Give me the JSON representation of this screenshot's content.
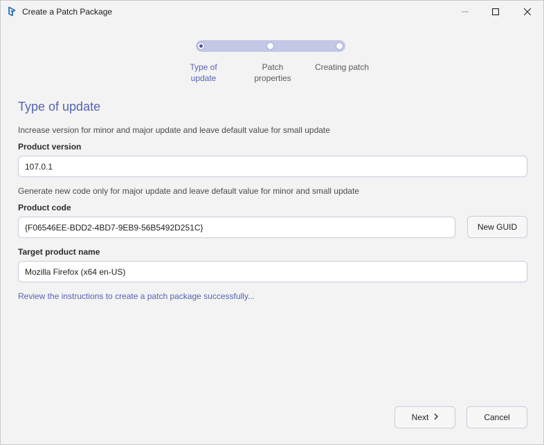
{
  "window": {
    "title": "Create a Patch Package"
  },
  "stepper": {
    "steps": [
      {
        "label_line1": "Type of",
        "label_line2": "update"
      },
      {
        "label_line1": "Patch",
        "label_line2": "properties"
      },
      {
        "label_line1": "Creating patch",
        "label_line2": ""
      }
    ],
    "active_step": 1
  },
  "form": {
    "title": "Type of update",
    "version_hint": "Increase version for minor and major update and leave default value for small update",
    "version_label": "Product version",
    "version_value": "107.0.1",
    "code_hint": "Generate new code only for major update and leave default value for minor and small update",
    "code_label": "Product code",
    "code_value": "{F06546EE-BDD2-4BD7-9EB9-56B5492D251C}",
    "new_guid_label": "New GUID",
    "target_label": "Target product name",
    "target_value": "Mozilla Firefox (x64 en-US)",
    "instructions_link": "Review the instructions to create a patch package successfully..."
  },
  "footer": {
    "next_label": "Next",
    "cancel_label": "Cancel"
  },
  "colors": {
    "accent": "#5563b5",
    "stepper_track": "#c4c8e6",
    "background": "#f3f3f3"
  },
  "icons": {
    "app": "patch-package-app-icon",
    "minimize": "minimize-icon",
    "maximize": "maximize-icon",
    "close": "close-icon",
    "next": "chevron-right-icon"
  }
}
